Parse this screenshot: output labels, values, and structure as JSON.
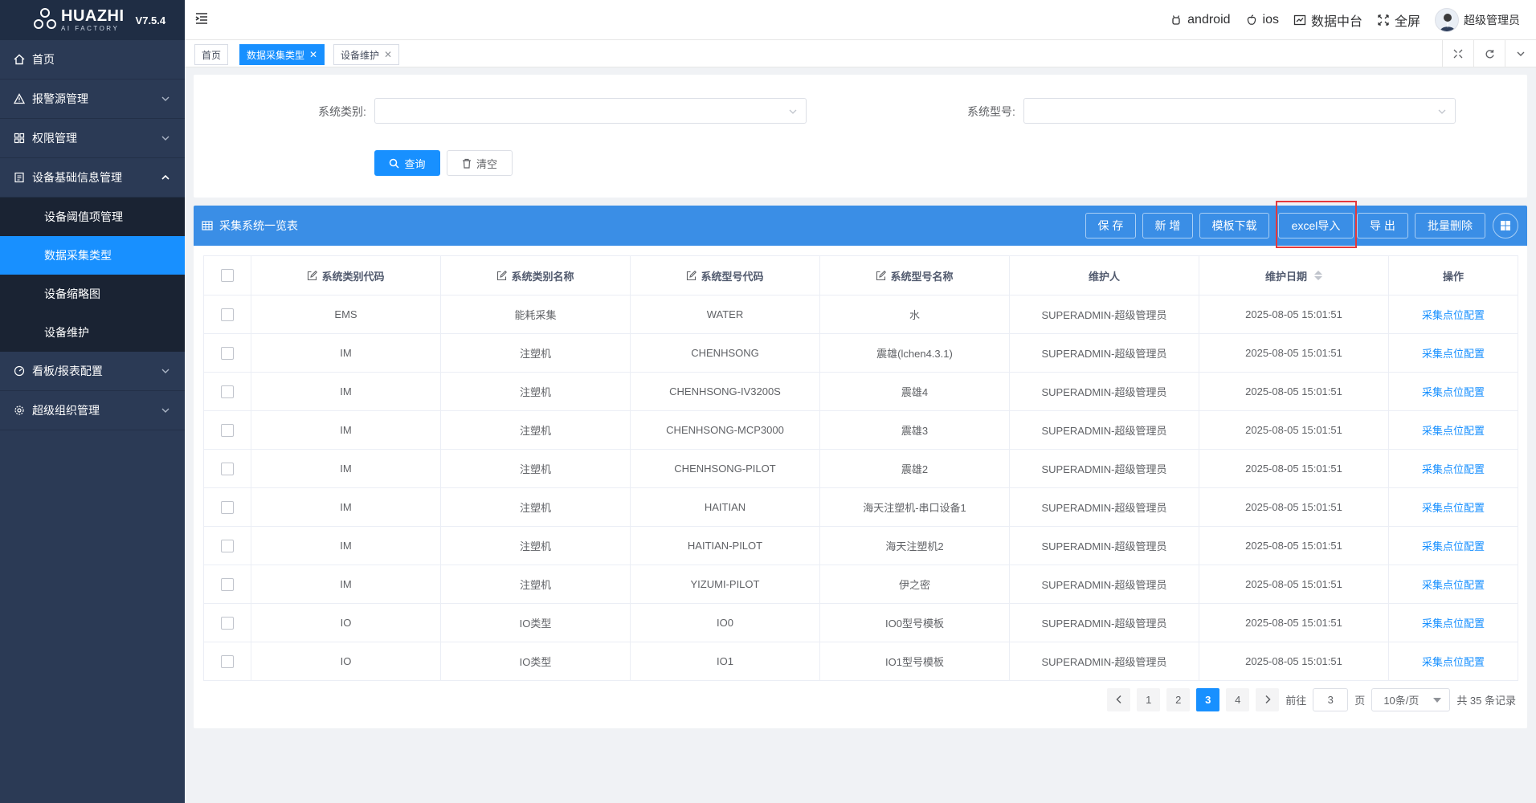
{
  "app": {
    "brand": "HUAZHI",
    "brand_sub": "AI FACTORY",
    "version": "V7.5.4"
  },
  "sidebar": {
    "items": [
      {
        "label": "首页",
        "icon": "home-icon"
      },
      {
        "label": "报警源管理",
        "icon": "warning-icon"
      },
      {
        "label": "权限管理",
        "icon": "grid-icon"
      },
      {
        "label": "设备基础信息管理",
        "icon": "device-icon"
      },
      {
        "label": "看板/报表配置",
        "icon": "dashboard-icon"
      },
      {
        "label": "超级组织管理",
        "icon": "gear-icon"
      }
    ],
    "sub_items": [
      {
        "label": "设备阈值项管理"
      },
      {
        "label": "数据采集类型"
      },
      {
        "label": "设备缩略图"
      },
      {
        "label": "设备维护"
      }
    ]
  },
  "header": {
    "android": "android",
    "ios": "ios",
    "data_center": "数据中台",
    "fullscreen": "全屏",
    "user": "超级管理员"
  },
  "tabs": [
    {
      "label": "首页"
    },
    {
      "label": "数据采集类型"
    },
    {
      "label": "设备维护"
    }
  ],
  "search": {
    "sys_type_label": "系统类别:",
    "sys_model_label": "系统型号:",
    "query_btn": "查询",
    "clear_btn": "清空"
  },
  "table_panel": {
    "title": "采集系统一览表",
    "buttons": {
      "save": "保 存",
      "add": "新 增",
      "template": "模板下载",
      "excel_import": "excel导入",
      "export": "导 出",
      "batch_delete": "批量删除"
    }
  },
  "table": {
    "headers": {
      "sys_type_code": "系统类别代码",
      "sys_type_name": "系统类别名称",
      "sys_model_code": "系统型号代码",
      "sys_model_name": "系统型号名称",
      "maintainer": "维护人",
      "maintain_date": "维护日期",
      "operation": "操作"
    },
    "rows": [
      {
        "type_code": "EMS",
        "type_name": "能耗采集",
        "model_code": "WATER",
        "model_name": "水",
        "maintainer": "SUPERADMIN-超级管理员",
        "date": "2025-08-05 15:01:51",
        "op": "采集点位配置"
      },
      {
        "type_code": "IM",
        "type_name": "注塑机",
        "model_code": "CHENHSONG",
        "model_name": "震雄(lchen4.3.1)",
        "maintainer": "SUPERADMIN-超级管理员",
        "date": "2025-08-05 15:01:51",
        "op": "采集点位配置"
      },
      {
        "type_code": "IM",
        "type_name": "注塑机",
        "model_code": "CHENHSONG-IV3200S",
        "model_name": "震雄4",
        "maintainer": "SUPERADMIN-超级管理员",
        "date": "2025-08-05 15:01:51",
        "op": "采集点位配置"
      },
      {
        "type_code": "IM",
        "type_name": "注塑机",
        "model_code": "CHENHSONG-MCP3000",
        "model_name": "震雄3",
        "maintainer": "SUPERADMIN-超级管理员",
        "date": "2025-08-05 15:01:51",
        "op": "采集点位配置"
      },
      {
        "type_code": "IM",
        "type_name": "注塑机",
        "model_code": "CHENHSONG-PILOT",
        "model_name": "震雄2",
        "maintainer": "SUPERADMIN-超级管理员",
        "date": "2025-08-05 15:01:51",
        "op": "采集点位配置"
      },
      {
        "type_code": "IM",
        "type_name": "注塑机",
        "model_code": "HAITIAN",
        "model_name": "海天注塑机-串口设备1",
        "maintainer": "SUPERADMIN-超级管理员",
        "date": "2025-08-05 15:01:51",
        "op": "采集点位配置"
      },
      {
        "type_code": "IM",
        "type_name": "注塑机",
        "model_code": "HAITIAN-PILOT",
        "model_name": "海天注塑机2",
        "maintainer": "SUPERADMIN-超级管理员",
        "date": "2025-08-05 15:01:51",
        "op": "采集点位配置"
      },
      {
        "type_code": "IM",
        "type_name": "注塑机",
        "model_code": "YIZUMI-PILOT",
        "model_name": "伊之密",
        "maintainer": "SUPERADMIN-超级管理员",
        "date": "2025-08-05 15:01:51",
        "op": "采集点位配置"
      },
      {
        "type_code": "IO",
        "type_name": "IO类型",
        "model_code": "IO0",
        "model_name": "IO0型号模板",
        "maintainer": "SUPERADMIN-超级管理员",
        "date": "2025-08-05 15:01:51",
        "op": "采集点位配置"
      },
      {
        "type_code": "IO",
        "type_name": "IO类型",
        "model_code": "IO1",
        "model_name": "IO1型号模板",
        "maintainer": "SUPERADMIN-超级管理员",
        "date": "2025-08-05 15:01:51",
        "op": "采集点位配置"
      }
    ]
  },
  "pagination": {
    "pages": [
      "1",
      "2",
      "3",
      "4"
    ],
    "current": "3",
    "goto_label": "前往",
    "goto_value": "3",
    "page_unit": "页",
    "page_size": "10条/页",
    "total": "共 35 条记录"
  },
  "colors": {
    "sidebar_bg": "#2b3a55",
    "accent": "#1890ff",
    "panel_header": "#3a8ee6",
    "highlight_box": "#e4393c"
  }
}
